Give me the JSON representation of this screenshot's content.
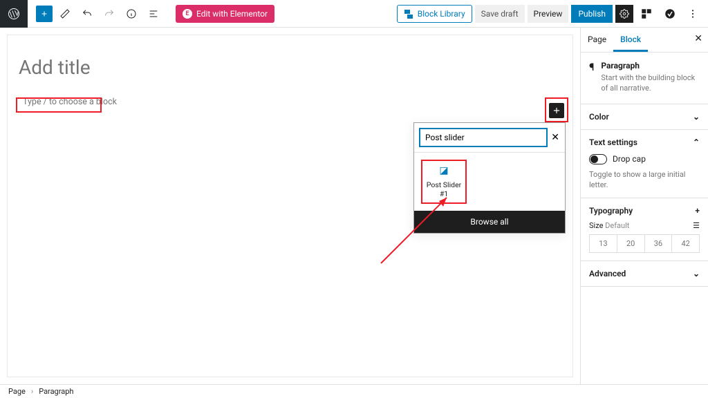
{
  "topbar": {
    "elementor_label": "Edit with Elementor",
    "block_library_label": "Block Library",
    "save_draft_label": "Save draft",
    "preview_label": "Preview",
    "publish_label": "Publish"
  },
  "canvas": {
    "title_placeholder": "Add title",
    "block_chooser_placeholder": "Type / to choose a block"
  },
  "popover": {
    "search_value": "Post slider",
    "result_label": "Post Slider #1",
    "browse_all_label": "Browse all"
  },
  "sidebar": {
    "tabs": {
      "page": "Page",
      "block": "Block"
    },
    "block_info": {
      "name": "Paragraph",
      "desc": "Start with the building block of all narrative."
    },
    "sections": {
      "color": "Color",
      "text_settings": "Text settings",
      "dropcap_label": "Drop cap",
      "dropcap_desc": "Toggle to show a large initial letter.",
      "typography": "Typography",
      "size_label": "Size",
      "size_default": "Default",
      "size_presets": [
        "13",
        "20",
        "36",
        "42"
      ],
      "advanced": "Advanced"
    }
  },
  "footer": {
    "crumb1": "Page",
    "crumb2": "Paragraph"
  }
}
